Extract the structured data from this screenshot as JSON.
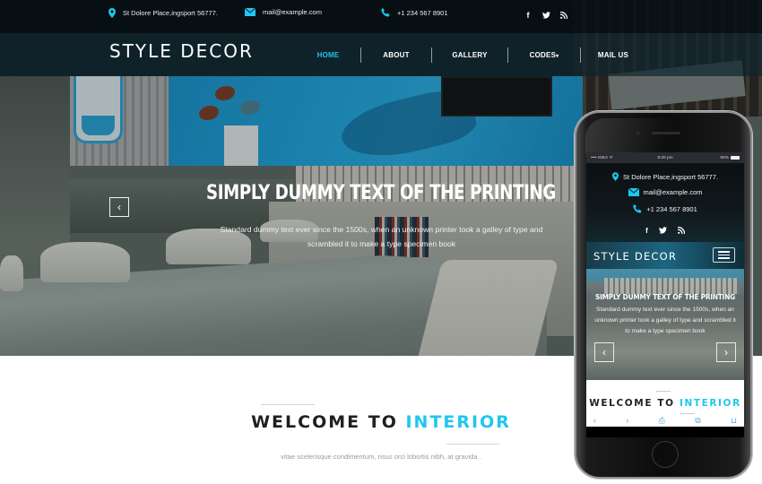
{
  "topbar": {
    "address": "St Dolore Place,ingsport 56777.",
    "email": "mail@example.com",
    "phone": "+1 234 567 8901",
    "socials": [
      {
        "icon": "facebook-icon",
        "glyph": "f"
      },
      {
        "icon": "twitter-icon",
        "glyph": "🐦"
      },
      {
        "icon": "rss-icon",
        "glyph": "⌇"
      }
    ]
  },
  "brand": {
    "logo": "STYLE DECOR"
  },
  "nav": {
    "items": [
      {
        "label": "HOME",
        "active": true
      },
      {
        "label": "ABOUT"
      },
      {
        "label": "GALLERY"
      },
      {
        "label": "CODES",
        "caret": "▾"
      },
      {
        "label": "MAIL US"
      }
    ]
  },
  "hero": {
    "title": "SIMPLY DUMMY TEXT OF THE PRINTING",
    "description": "Standard dummy text ever since the 1500s, when an unknown printer took a galley of type and scrambled it to make a type specimen book",
    "prev_glyph": "‹",
    "next_glyph": "›"
  },
  "welcome": {
    "title_plain": "WELCOME TO",
    "title_accent": "INTERIOR",
    "subtitle": "vitae scelerisque condimentum, risus orci lobortis nibh, at gravida ."
  },
  "phone": {
    "status": {
      "carrier": "•••• IDEA ᯤ",
      "time": "9:20 pm",
      "battery": "90%"
    },
    "toolbar": [
      "‹",
      "›",
      "⎙",
      "⧉",
      "⊔"
    ]
  },
  "colors": {
    "accent": "#20c6ee",
    "topbar_bg": "#050e14",
    "nav_bg": "#0e262e",
    "text_dark": "#1f1f1f"
  }
}
